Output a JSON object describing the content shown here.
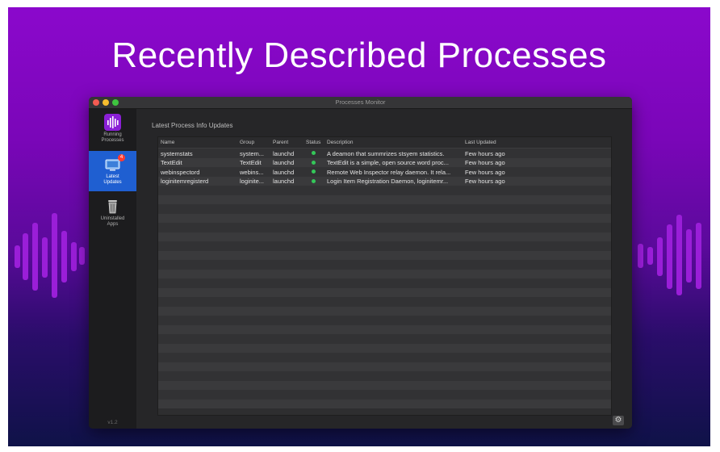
{
  "headline": "Recently Described Processes",
  "colors": {
    "background_top": "#8b08cc",
    "background_bottom": "#0f1248",
    "sidebar_active": "#1f5fd1",
    "status_running": "#34c759"
  },
  "window": {
    "title": "Processes Monitor"
  },
  "sidebar": {
    "items": [
      {
        "label": "Running\nProcesses",
        "icon": "waveform-icon",
        "active": false
      },
      {
        "label": "Latest\nUpdates",
        "icon": "monitor-icon",
        "active": true,
        "badge": "4"
      },
      {
        "label": "Uninstalled\nApps",
        "icon": "trash-icon",
        "active": false
      }
    ],
    "version": "v1.2"
  },
  "main": {
    "title": "Latest Process Info Updates",
    "columns": [
      "Name",
      "Group",
      "Parent",
      "Status",
      "Description",
      "Last Updated"
    ],
    "rows": [
      {
        "name": "systemstats",
        "group": "system...",
        "parent": "launchd",
        "status": "running",
        "description": "A deamon that summrizes stsyem statistics.",
        "updated": "Few hours ago"
      },
      {
        "name": "TextEdit",
        "group": "TextEdit",
        "parent": "launchd",
        "status": "running",
        "description": "TextEdit is a simple, open source word proc...",
        "updated": "Few hours ago"
      },
      {
        "name": "webinspectord",
        "group": "webins...",
        "parent": "launchd",
        "status": "running",
        "description": "Remote Web Inspector relay daemon. It rela...",
        "updated": "Few hours ago"
      },
      {
        "name": "loginitemregisterd",
        "group": "loginite...",
        "parent": "launchd",
        "status": "running",
        "description": "Login Item Registration Daemon, loginitemr...",
        "updated": "Few hours ago"
      }
    ]
  },
  "footer": {
    "settings_icon": "gear-icon",
    "settings_glyph": "⚙"
  }
}
